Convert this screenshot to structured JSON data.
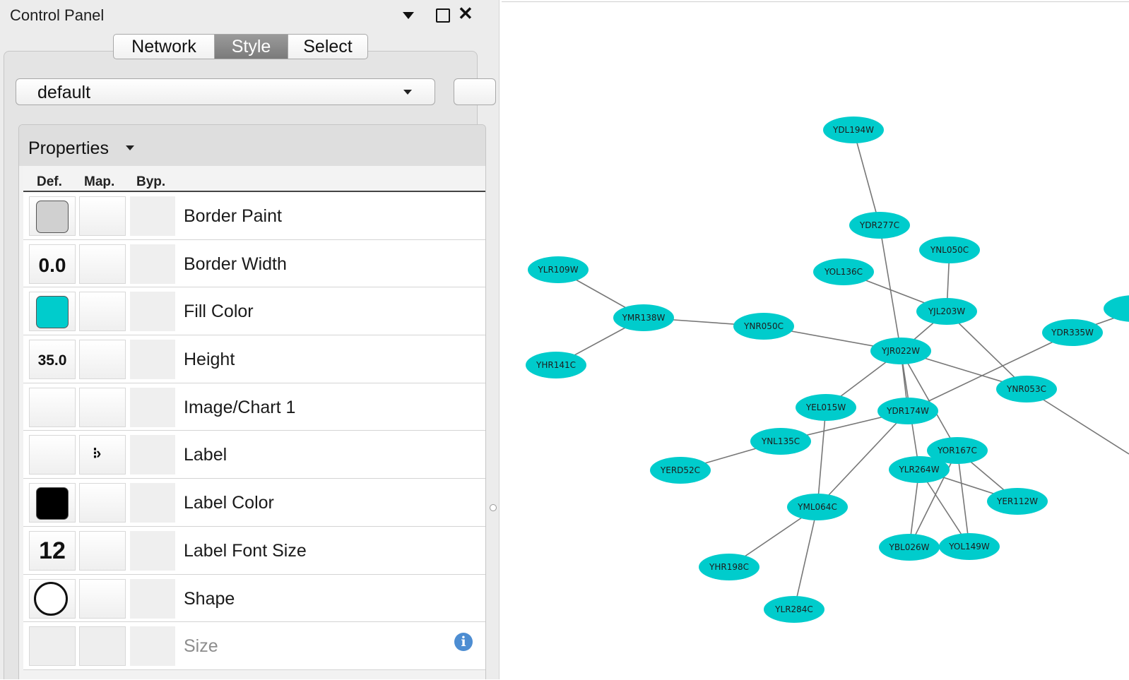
{
  "panel": {
    "title": "Control Panel",
    "tabs": [
      {
        "label": "Network",
        "active": false
      },
      {
        "label": "Style",
        "active": true
      },
      {
        "label": "Select",
        "active": false
      }
    ],
    "style_selector": {
      "value": "default"
    },
    "properties": {
      "title": "Properties",
      "columns": {
        "def": "Def.",
        "map": "Map.",
        "byp": "Byp."
      },
      "rows": [
        {
          "name": "Border Paint",
          "def_type": "color",
          "def_color": "#d0d0d0"
        },
        {
          "name": "Border Width",
          "def_type": "text",
          "def_value": "0.0"
        },
        {
          "name": "Fill Color",
          "def_type": "color",
          "def_color": "#00cccc"
        },
        {
          "name": "Height",
          "def_type": "text",
          "def_value": "35.0"
        },
        {
          "name": "Image/Chart 1",
          "def_type": "none"
        },
        {
          "name": "Label",
          "def_type": "none",
          "map_icon": "mapping-arrow-icon"
        },
        {
          "name": "Label Color",
          "def_type": "color",
          "def_color": "#000000"
        },
        {
          "name": "Label Font Size",
          "def_type": "text",
          "def_value": "12"
        },
        {
          "name": "Shape",
          "def_type": "shape",
          "def_shape": "ellipse"
        },
        {
          "name": "Size",
          "def_type": "none",
          "disabled": true,
          "info_icon": "info-icon"
        }
      ]
    }
  },
  "network": {
    "node_color": "#00cccc",
    "edge_color": "#777777",
    "nodes": [
      {
        "id": "YDL194W"
      },
      {
        "id": "YDR277C"
      },
      {
        "id": "YNL050C"
      },
      {
        "id": "YOL136C"
      },
      {
        "id": "YLR109W"
      },
      {
        "id": "YJL203W"
      },
      {
        "id": "YMR138W"
      },
      {
        "id": "YNR050C"
      },
      {
        "id": "YDR335W"
      },
      {
        "id": "YJR022W"
      },
      {
        "id": "YHR141C"
      },
      {
        "id": "YNR053C"
      },
      {
        "id": "YEL015W"
      },
      {
        "id": "YDR174W"
      },
      {
        "id": "YNL135C"
      },
      {
        "id": "YOR167C"
      },
      {
        "id": "YERD52C"
      },
      {
        "id": "YLR264W"
      },
      {
        "id": "YER112W"
      },
      {
        "id": "YML064C"
      },
      {
        "id": "YBL026W"
      },
      {
        "id": "YOL149W"
      },
      {
        "id": "YHR198C"
      },
      {
        "id": "YLR284C"
      }
    ],
    "edges": [
      [
        "YDL194W",
        "YDR277C"
      ],
      [
        "YDR277C",
        "YJR022W"
      ],
      [
        "YLR109W",
        "YMR138W"
      ],
      [
        "YHR141C",
        "YMR138W"
      ],
      [
        "YMR138W",
        "YNR050C"
      ],
      [
        "YNR050C",
        "YJR022W"
      ],
      [
        "YOL136C",
        "YJL203W"
      ],
      [
        "YNL050C",
        "YJL203W"
      ],
      [
        "YJL203W",
        "YJR022W"
      ],
      [
        "YJL203W",
        "YNR053C"
      ],
      [
        "YJR022W",
        "YNR053C"
      ],
      [
        "YJR022W",
        "YEL015W"
      ],
      [
        "YJR022W",
        "YDR174W"
      ],
      [
        "YJR022W",
        "YOR167C"
      ],
      [
        "YJR022W",
        "YLR264W"
      ],
      [
        "YDR174W",
        "YDR335W"
      ],
      [
        "YDR174W",
        "YNL135C"
      ],
      [
        "YDR174W",
        "YML064C"
      ],
      [
        "YNL135C",
        "YERD52C"
      ],
      [
        "YEL015W",
        "YML064C"
      ],
      [
        "YML064C",
        "YHR198C"
      ],
      [
        "YML064C",
        "YLR284C"
      ],
      [
        "YOR167C",
        "YER112W"
      ],
      [
        "YOR167C",
        "YBL026W"
      ],
      [
        "YOR167C",
        "YOL149W"
      ],
      [
        "YLR264W",
        "YBL026W"
      ],
      [
        "YLR264W",
        "YOL149W"
      ],
      [
        "YLR264W",
        "YER112W"
      ]
    ]
  }
}
